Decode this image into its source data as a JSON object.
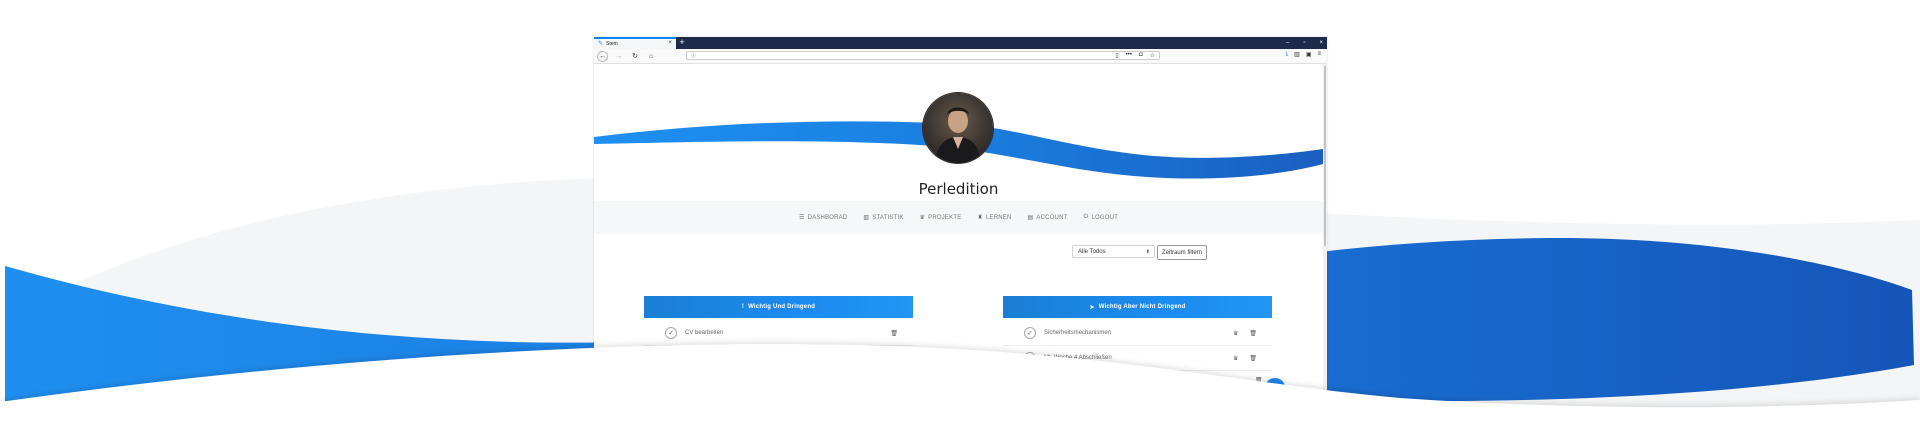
{
  "browser": {
    "tab_title": "Stem",
    "new_tab_symbol": "+",
    "window_controls": [
      "–",
      "▫",
      "×"
    ],
    "url_text": "",
    "colors": {
      "tabbar": "#1e2a4a",
      "accent": "#0a84ff"
    }
  },
  "profile": {
    "name": "Perledition",
    "avatar_icon": "user-photo"
  },
  "nav": {
    "items": [
      {
        "label": "DASHBORAD",
        "icon": "list-icon",
        "glyph": "☰"
      },
      {
        "label": "STATISTIK",
        "icon": "chart-icon",
        "glyph": "▥"
      },
      {
        "label": "PROJEKTE",
        "icon": "trophy-icon",
        "glyph": "♛"
      },
      {
        "label": "LERNEN",
        "icon": "graduation-cap-icon",
        "glyph": "♜"
      },
      {
        "label": "ACCOUNT",
        "icon": "id-card-icon",
        "glyph": "▤"
      },
      {
        "label": "LOGOUT",
        "icon": "power-icon",
        "glyph": "⏻"
      }
    ]
  },
  "filter": {
    "select_value": "Alle Todos",
    "button_label": "Zeitraum filtern"
  },
  "columns": [
    {
      "header": "Wichtig Und Dringend",
      "header_icon": "exclamation-icon",
      "header_glyph": "!",
      "items": [
        {
          "text": "CV bearbeiten",
          "has_trophy": false
        }
      ]
    },
    {
      "header": "Wichtig Aber Nicht Dringend",
      "header_icon": "rocket-icon",
      "header_glyph": "➤",
      "items": [
        {
          "text": "Sicherheitsmechanismen",
          "has_trophy": true
        },
        {
          "text": "ML Woche 4 Abschließen",
          "has_trophy": true
        }
      ]
    }
  ],
  "colors": {
    "brand_blue": "#1e88e5",
    "wave_dark": "#1a5fbf",
    "wave_light": "#2196f3"
  }
}
